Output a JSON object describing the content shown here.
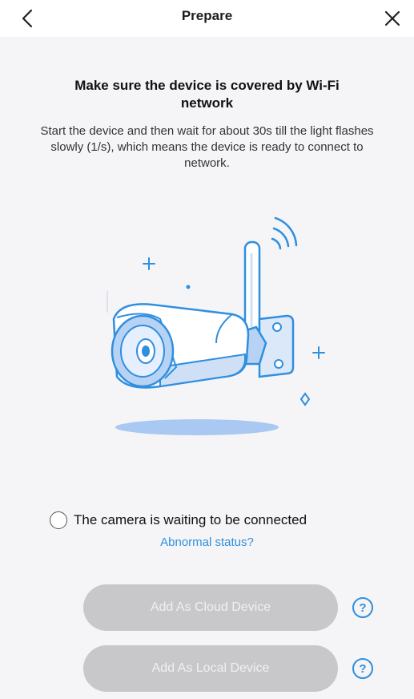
{
  "header": {
    "title": "Prepare",
    "back_icon": "chevron-left-icon",
    "close_icon": "close-icon"
  },
  "instructions": {
    "heading": "Make sure the device is covered by Wi-Fi network",
    "description": "Start the device and then wait for about 30s till the light flashes slowly (1/s), which means the device is ready to connect to network."
  },
  "illustration": {
    "icon": "wifi-camera-icon"
  },
  "status": {
    "text": "The camera is waiting to be connected",
    "link": "Abnormal status?",
    "checked": false
  },
  "actions": {
    "cloud_label": "Add As Cloud Device",
    "local_label": "Add As Local Device",
    "help_icon": "help-icon",
    "help_glyph": "?"
  },
  "colors": {
    "accent": "#2f8fe0",
    "button_disabled": "#c8c8ca",
    "background": "#f5f5f7"
  }
}
